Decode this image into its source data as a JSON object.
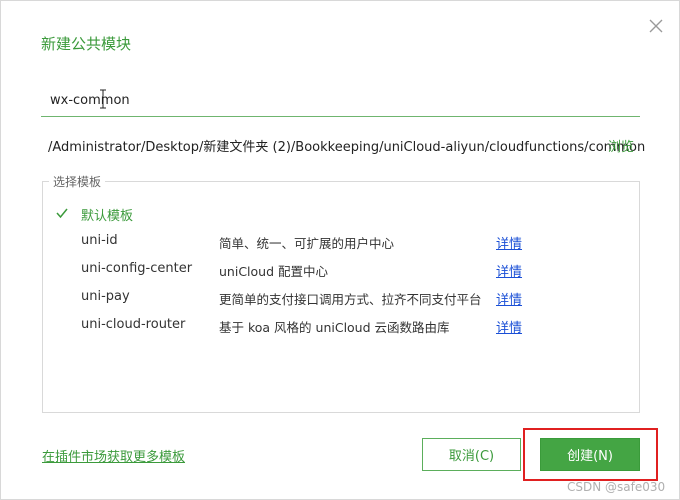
{
  "dialog": {
    "title": "新建公共模块",
    "close_icon": "close-icon"
  },
  "module_name": {
    "value": "wx-common"
  },
  "path": {
    "value": "/Administrator/Desktop/新建文件夹 (2)/Bookkeeping/uniCloud-aliyun/cloudfunctions/common",
    "browse_label": "浏览"
  },
  "templates": {
    "legend": "选择模板",
    "items": [
      {
        "name": "默认模板",
        "description": "",
        "detail_label": "",
        "selected": true
      },
      {
        "name": "uni-id",
        "description": "简单、统一、可扩展的用户中心",
        "detail_label": "详情",
        "selected": false
      },
      {
        "name": "uni-config-center",
        "description": "uniCloud 配置中心",
        "detail_label": "详情",
        "selected": false
      },
      {
        "name": "uni-pay",
        "description": "更简单的支付接口调用方式、拉齐不同支付平台",
        "detail_label": "详情",
        "selected": false
      },
      {
        "name": "uni-cloud-router",
        "description": "基于 koa 风格的 uniCloud 云函数路由库",
        "detail_label": "详情",
        "selected": false
      }
    ]
  },
  "footer": {
    "more_templates_link": "在插件市场获取更多模板",
    "cancel_label": "取消(C)",
    "create_label": "创建(N)"
  },
  "watermark": "CSDN @safe030",
  "colors": {
    "accent": "#3b9a3b",
    "primary_button": "#44a544",
    "link_blue": "#1a4fd6",
    "highlight_red": "#e02020"
  }
}
